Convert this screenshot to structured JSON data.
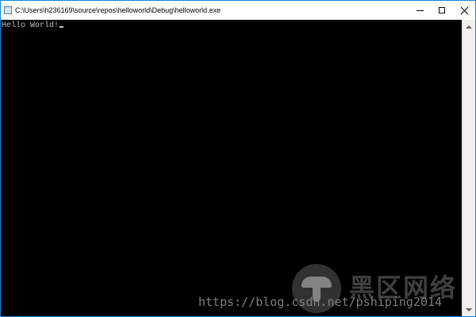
{
  "window": {
    "title": "C:\\Users\\h236169\\source\\repos\\helloworld\\Debug\\helloworld.exe"
  },
  "console": {
    "output_line": "Hello World!"
  },
  "watermark": {
    "url_text": "https://blog.csdn.net/pshiping2014",
    "brand_text": "黑区网络"
  },
  "icons": [
    "console-app-icon",
    "minimize-icon",
    "maximize-icon",
    "close-icon",
    "scroll-up-arrow-icon",
    "scroll-down-arrow-icon",
    "mushroom-logo-icon"
  ],
  "colors": {
    "window_border": "#1883d7",
    "console_bg": "#000000",
    "console_text": "#c0c0c0",
    "titlebar_bg": "#ffffff"
  }
}
